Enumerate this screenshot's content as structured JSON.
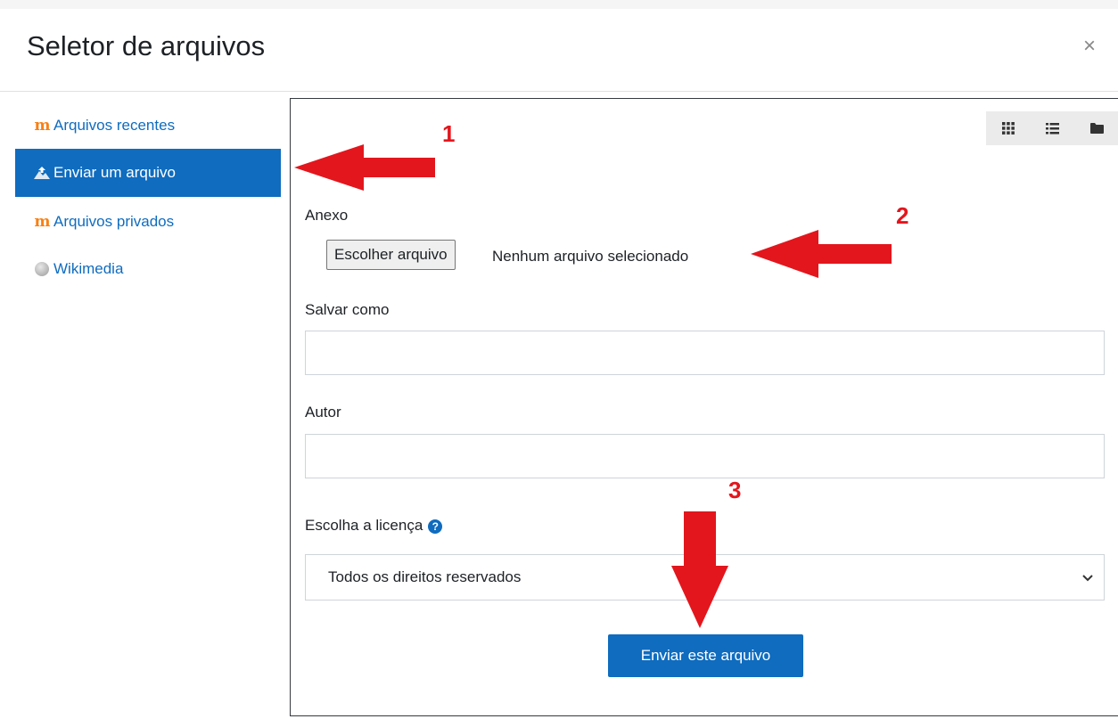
{
  "dialog": {
    "title": "Seletor de arquivos",
    "close_symbol": "×"
  },
  "sidebar": {
    "items": [
      {
        "label": "Arquivos recentes",
        "icon": "moodle-icon",
        "active": false
      },
      {
        "label": "Enviar um arquivo",
        "icon": "upload-icon",
        "active": true
      },
      {
        "label": "Arquivos privados",
        "icon": "moodle-icon",
        "active": false
      },
      {
        "label": "Wikimedia",
        "icon": "wikimedia-icon",
        "active": false
      }
    ]
  },
  "view_buttons": [
    "grid-view-icon",
    "list-view-icon",
    "folder-view-icon"
  ],
  "form": {
    "attachment_label": "Anexo",
    "choose_file_button": "Escolher arquivo",
    "no_file_text": "Nenhum arquivo selecionado",
    "save_as_label": "Salvar como",
    "save_as_value": "",
    "author_label": "Autor",
    "author_value": "",
    "license_label": "Escolha a licença",
    "license_selected": "Todos os direitos reservados",
    "submit_button": "Enviar este arquivo"
  },
  "annotations": {
    "numbers": [
      "1",
      "2",
      "3"
    ],
    "arrow_color": "#e3161d"
  },
  "colors": {
    "accent": "#0f6cbf",
    "moodle_orange": "#f98012"
  }
}
